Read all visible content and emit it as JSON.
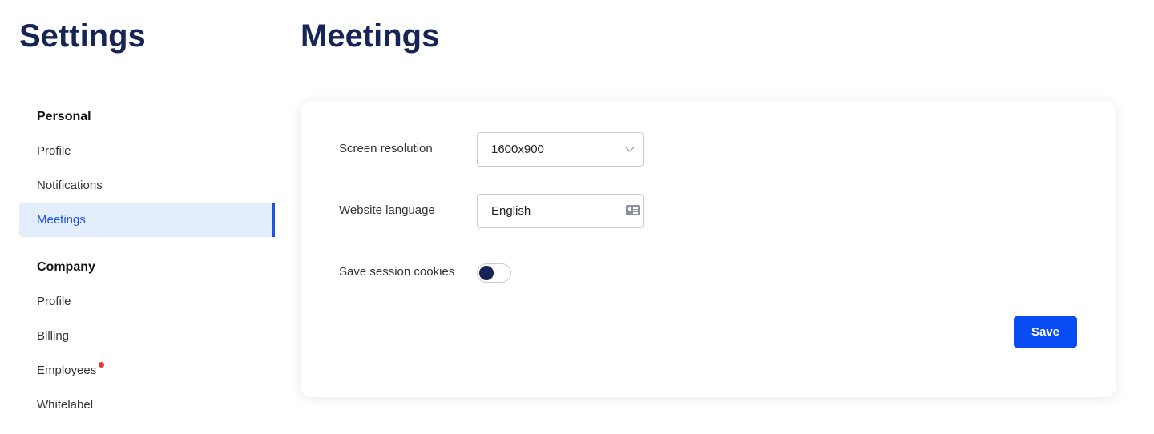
{
  "sidebar": {
    "title": "Settings",
    "groups": [
      {
        "heading": "Personal",
        "items": [
          {
            "label": "Profile"
          },
          {
            "label": "Notifications"
          },
          {
            "label": "Meetings",
            "active": true
          }
        ]
      },
      {
        "heading": "Company",
        "items": [
          {
            "label": "Profile"
          },
          {
            "label": "Billing"
          },
          {
            "label": "Employees",
            "badge": "red-dot"
          },
          {
            "label": "Whitelabel"
          }
        ]
      }
    ]
  },
  "main": {
    "title": "Meetings",
    "form": {
      "screen_resolution": {
        "label": "Screen resolution",
        "value": "1600x900"
      },
      "website_language": {
        "label": "Website language",
        "value": "English",
        "icon": "contact-card-icon"
      },
      "save_session_cookies": {
        "label": "Save session cookies",
        "enabled": false
      },
      "save_label": "Save"
    }
  },
  "colors": {
    "title": "#162456",
    "accent": "#0a4cf4",
    "active_bg": "#e4edfc",
    "active_text": "#1b55e0",
    "badge": "#e53935"
  }
}
